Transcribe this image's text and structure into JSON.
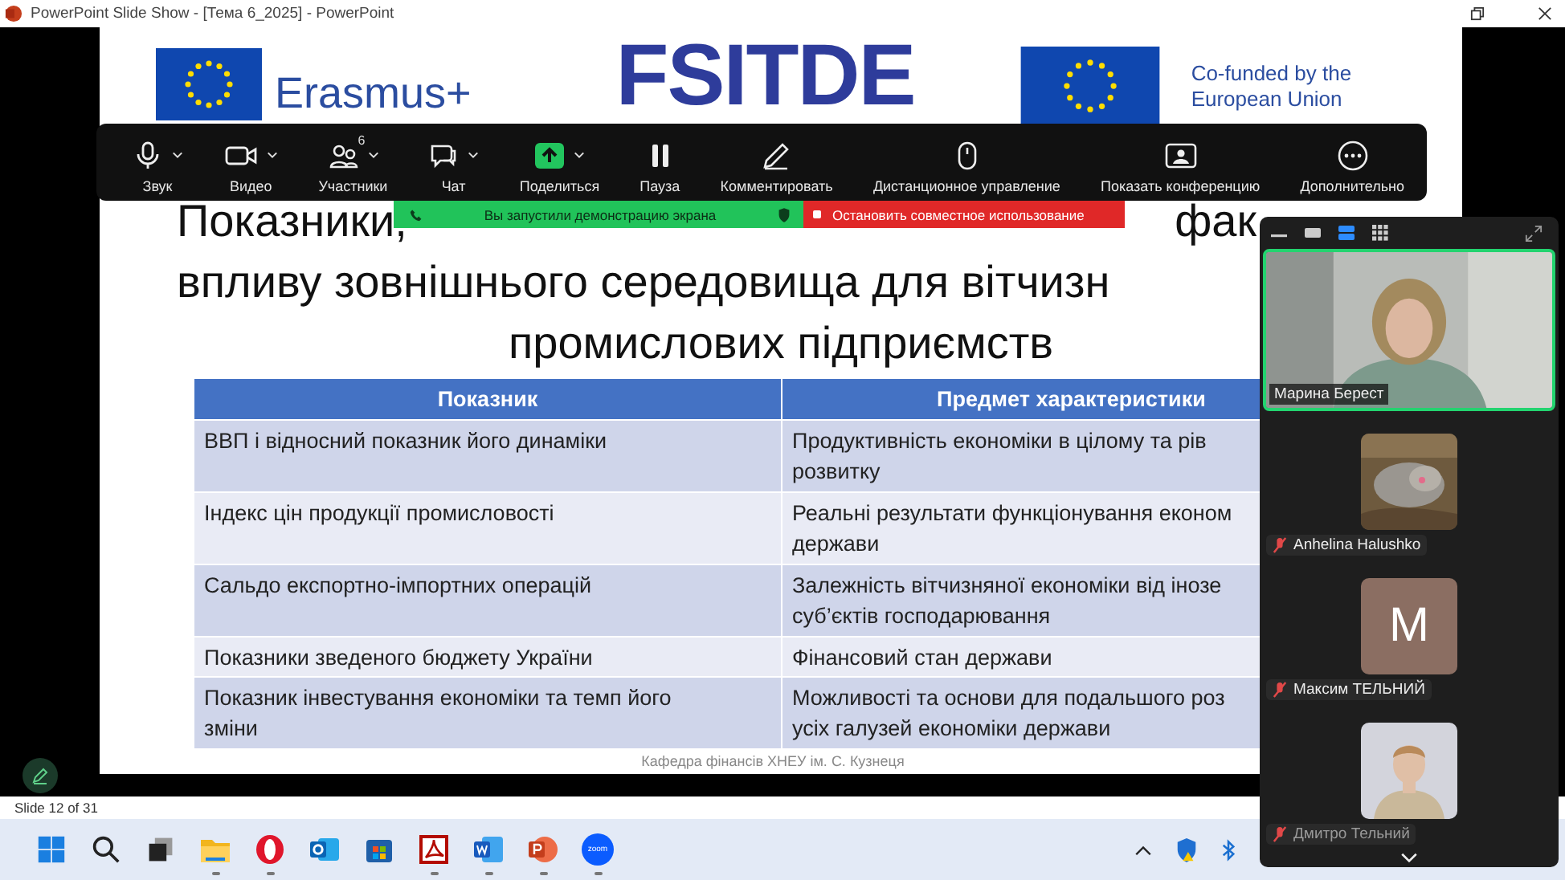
{
  "window": {
    "title": "PowerPoint Slide Show - [Тема 6_2025] - PowerPoint"
  },
  "slide": {
    "logos": {
      "erasmus": "Erasmus+",
      "project": "FSITDE",
      "cofunded": [
        "Co-funded by the",
        "European Union"
      ]
    },
    "title_first_line": {
      "left": "Показники,",
      "right": "фак"
    },
    "title_lines": [
      "впливу зовнішнього середовища для вітчизн",
      "промислових підприємств"
    ],
    "table": {
      "columns": [
        "Показник",
        "Предмет характеристики"
      ],
      "rows": [
        {
          "cells": [
            [
              "ВВП і відносний показник його динаміки"
            ],
            [
              "Продуктивність економіки в цілому та рів",
              "розвитку"
            ]
          ]
        },
        {
          "cells": [
            [
              "Індекс цін продукції промисловості"
            ],
            [
              "Реальні результати функціонування економ",
              "держави"
            ]
          ]
        },
        {
          "cells": [
            [
              "Сальдо експортно-імпортних операцій"
            ],
            [
              "Залежність вітчизняної економіки від інозе",
              "суб’єктів господарювання"
            ]
          ]
        },
        {
          "cells": [
            [
              "Показники зведеного бюджету України"
            ],
            [
              "Фінансовий стан держави"
            ]
          ]
        },
        {
          "cells": [
            [
              "Показник інвестування економіки та темп його",
              "зміни"
            ],
            [
              "Можливості та основи для подальшого роз",
              "усіх галузей економіки держави"
            ]
          ]
        }
      ]
    },
    "footer": "Кафедра фінансів ХНЕУ ім. С. Кузнеця"
  },
  "zoom_toolbar": {
    "items": [
      {
        "kind": "mic",
        "label": "Звук",
        "caret": true
      },
      {
        "kind": "camera",
        "label": "Видео",
        "caret": true
      },
      {
        "kind": "people",
        "label": "Участники",
        "caret": true,
        "badge": "6"
      },
      {
        "kind": "chat",
        "label": "Чат",
        "caret": true
      },
      {
        "kind": "share",
        "label": "Поделиться",
        "caret": true
      },
      {
        "kind": "pause",
        "label": "Пауза",
        "caret": false
      },
      {
        "kind": "pen",
        "label": "Комментировать",
        "caret": false
      },
      {
        "kind": "mouse",
        "label": "Дистанционное управление",
        "caret": false
      },
      {
        "kind": "screen",
        "label": "Показать конференцию",
        "caret": false
      },
      {
        "kind": "more",
        "label": "Дополнительно",
        "caret": false
      }
    ]
  },
  "share_banner": {
    "message": "Вы запустили демонстрацию экрана",
    "stop": "Остановить совместное использование"
  },
  "participants_panel": {
    "views": [
      {
        "kind": "single",
        "selected": false
      },
      {
        "kind": "speaker",
        "selected": true
      },
      {
        "kind": "grid",
        "selected": false
      }
    ],
    "participants": [
      {
        "name": "Марина Берест",
        "kind": "video",
        "speaking": true,
        "muted": false
      },
      {
        "name": "Anhelina Halushko",
        "kind": "video",
        "speaking": false,
        "muted": true
      },
      {
        "name": "Максим ТЕЛЬНИЙ",
        "kind": "avatar",
        "initial": "M",
        "speaking": false,
        "muted": true
      },
      {
        "name": "Дмитро Тельний",
        "kind": "video",
        "speaking": false,
        "muted": true
      }
    ]
  },
  "status_bar": {
    "slide": "Slide 12 of 31"
  },
  "taskbar": {
    "apps": [
      {
        "kind": "windows",
        "running": false
      },
      {
        "kind": "search",
        "running": false
      },
      {
        "kind": "taskview",
        "running": false
      },
      {
        "kind": "explorer",
        "running": true
      },
      {
        "kind": "opera",
        "running": true
      },
      {
        "kind": "outlook",
        "running": false
      },
      {
        "kind": "store",
        "running": false
      },
      {
        "kind": "acrobat",
        "running": true
      },
      {
        "kind": "word",
        "running": true
      },
      {
        "kind": "powerpoint",
        "running": true
      },
      {
        "kind": "zoom",
        "running": true,
        "label": "zoom"
      }
    ],
    "tray": [
      {
        "kind": "chevron"
      },
      {
        "kind": "shield"
      },
      {
        "kind": "bluetooth"
      }
    ]
  }
}
